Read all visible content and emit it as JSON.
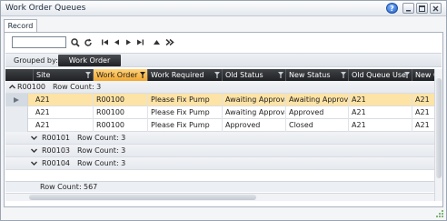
{
  "window": {
    "title": "Work Order Queues",
    "buttons": [
      "help-icon",
      "minimize-icon",
      "maximize-icon",
      "close-icon"
    ]
  },
  "tabs": [
    {
      "label": "Record"
    }
  ],
  "toolbar": {
    "search_value": "",
    "icons": [
      "search-icon",
      "refresh-icon",
      "first-page-icon",
      "prev-page-icon",
      "next-page-icon",
      "last-page-icon",
      "collapse-up-icon",
      "expand-all-icon"
    ]
  },
  "grouping": {
    "label": "Grouped by:",
    "chip": "Work Order"
  },
  "columns": [
    {
      "label": "Site"
    },
    {
      "label": "Work Order"
    },
    {
      "label": "Work Required"
    },
    {
      "label": "Old Status"
    },
    {
      "label": "New Status"
    },
    {
      "label": "Old Queue User"
    },
    {
      "label": "New Q"
    }
  ],
  "groups": [
    {
      "key": "R00100",
      "count_label": "Row Count: 3",
      "expanded": true,
      "rows": [
        {
          "site": "A21",
          "work_order": "R00100",
          "work_required": "Please Fix Pump",
          "old_status": "Awaiting Approval",
          "new_status": "Awaiting Approval",
          "old_queue_user": "A21",
          "new_queue_user": "A21",
          "selected": true
        },
        {
          "site": "A21",
          "work_order": "R00100",
          "work_required": "Please Fix Pump",
          "old_status": "Awaiting Approval",
          "new_status": "Approved",
          "old_queue_user": "A21",
          "new_queue_user": "A21",
          "selected": false
        },
        {
          "site": "A21",
          "work_order": "R00100",
          "work_required": "Please Fix Pump",
          "old_status": "Approved",
          "new_status": "Closed",
          "old_queue_user": "A21",
          "new_queue_user": "A21",
          "selected": false
        }
      ]
    },
    {
      "key": "R00101",
      "count_label": "Row Count: 3",
      "expanded": false,
      "rows": []
    },
    {
      "key": "R00103",
      "count_label": "Row Count: 3",
      "expanded": false,
      "rows": []
    },
    {
      "key": "R00104",
      "count_label": "Row Count: 3",
      "expanded": false,
      "rows": []
    }
  ],
  "footer": {
    "row_count_label": "Row Count:",
    "row_count_value": "567"
  },
  "colors": {
    "selected_row": "#fde3a5",
    "selected_header": "#f2a72f",
    "header_bg": "#2a2c30"
  }
}
